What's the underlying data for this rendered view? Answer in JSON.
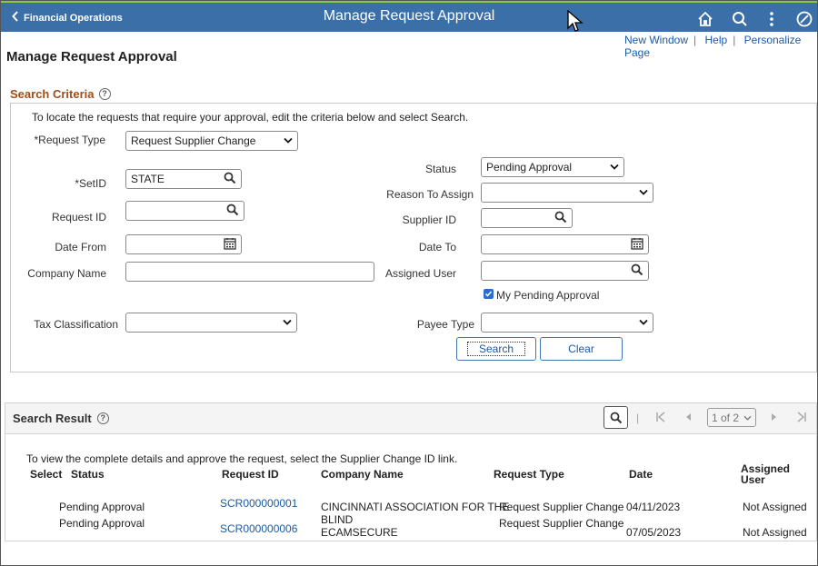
{
  "header": {
    "back_label": "Financial Operations",
    "title": "Manage Request Approval",
    "icons": [
      "home-icon",
      "search-icon",
      "more-icon",
      "navbar-icon"
    ]
  },
  "links": {
    "new_window": "New Window",
    "help": "Help",
    "personalize": "Personalize Page"
  },
  "page_title": "Manage Request Approval",
  "search_criteria": {
    "label": "Search Criteria",
    "instructions": "To locate the requests that require your approval, edit the criteria below and select Search.",
    "request_type": {
      "label": "*Request Type",
      "value": "Request Supplier Change"
    },
    "setid": {
      "label": "*SetID",
      "value": "STATE"
    },
    "request_id": {
      "label": "Request ID",
      "value": ""
    },
    "date_from": {
      "label": "Date From",
      "value": ""
    },
    "company_name": {
      "label": "Company Name",
      "value": ""
    },
    "tax_classification": {
      "label": "Tax Classification",
      "value": ""
    },
    "status": {
      "label": "Status",
      "value": "Pending Approval"
    },
    "reason_to_assign": {
      "label": "Reason To Assign",
      "value": ""
    },
    "supplier_id": {
      "label": "Supplier ID",
      "value": ""
    },
    "date_to": {
      "label": "Date To",
      "value": ""
    },
    "assigned_user": {
      "label": "Assigned User",
      "value": ""
    },
    "my_pending": {
      "label": "My Pending Approval",
      "checked": true
    },
    "payee_type": {
      "label": "Payee Type",
      "value": ""
    },
    "search_button": "Search",
    "clear_button": "Clear"
  },
  "search_result": {
    "label": "Search Result",
    "page_indicator": "1 of 2",
    "instructions": "To view the complete details and approve the request, select the Supplier Change ID link.",
    "columns": [
      "Select",
      "Status",
      "Request ID",
      "Company Name",
      "Request Type",
      "Date",
      "Assigned User"
    ],
    "rows": [
      {
        "status": "Pending Approval",
        "request_id": "SCR000000001",
        "company_name_line1": "CINCINNATI ASSOCIATION FOR THE",
        "company_name_line2": "BLIND",
        "request_type": "Request Supplier Change",
        "date": "04/11/2023",
        "assigned_user": "Not Assigned"
      },
      {
        "status": "Pending Approval",
        "request_id": "SCR000000006",
        "company_name_line1": "ECAMSECURE",
        "request_type": "Request Supplier Change",
        "date": "07/05/2023",
        "assigned_user": "Not Assigned"
      }
    ]
  }
}
